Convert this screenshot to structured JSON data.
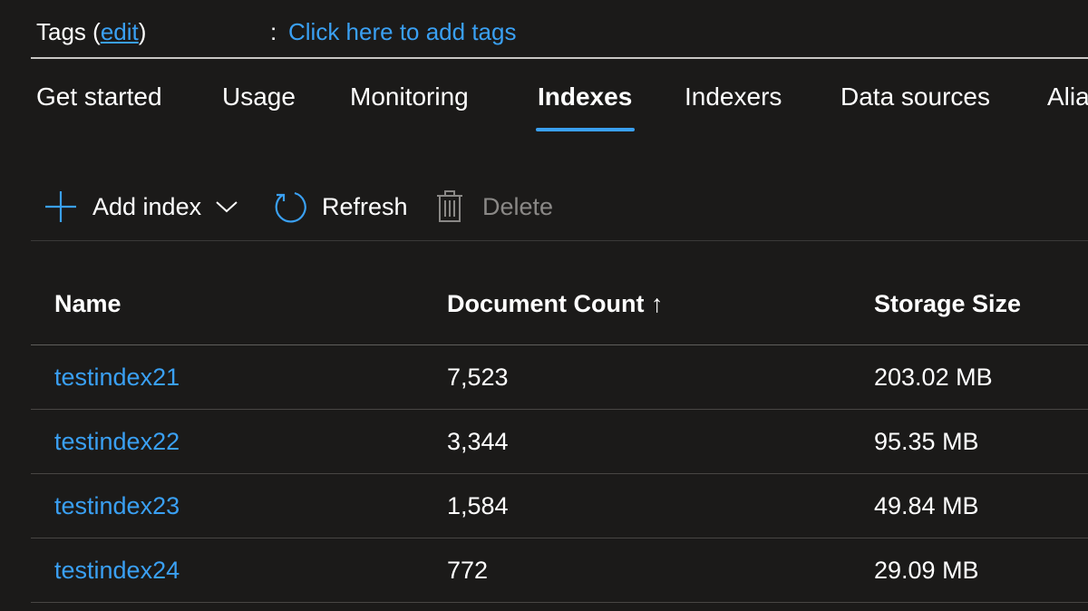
{
  "tags": {
    "label_prefix": "Tags (",
    "edit_link": "edit",
    "label_suffix": ")",
    "colon": ":",
    "value": "Click here to add tags"
  },
  "tabs": [
    {
      "label": "Get started",
      "active": false
    },
    {
      "label": "Usage",
      "active": false
    },
    {
      "label": "Monitoring",
      "active": false
    },
    {
      "label": "Indexes",
      "active": true
    },
    {
      "label": "Indexers",
      "active": false
    },
    {
      "label": "Data sources",
      "active": false
    },
    {
      "label": "Alia",
      "active": false
    }
  ],
  "toolbar": {
    "add_label": "Add index",
    "add_icon": "plus-icon",
    "dropdown_icon": "chevron-down-icon",
    "refresh_label": "Refresh",
    "refresh_icon": "refresh-icon",
    "delete_label": "Delete",
    "delete_icon": "trash-icon"
  },
  "table": {
    "columns": [
      "Name",
      "Document Count ↑",
      "Storage Size"
    ],
    "rows": [
      {
        "name": "testindex21",
        "count": "7,523",
        "size": "203.02 MB"
      },
      {
        "name": "testindex22",
        "count": "3,344",
        "size": "95.35 MB"
      },
      {
        "name": "testindex23",
        "count": "1,584",
        "size": "49.84 MB"
      },
      {
        "name": "testindex24",
        "count": "772",
        "size": "29.09 MB"
      }
    ]
  },
  "colors": {
    "background": "#1b1a19",
    "accent": "#3aa0f3",
    "text": "#ffffff",
    "disabled": "#8a8886"
  }
}
